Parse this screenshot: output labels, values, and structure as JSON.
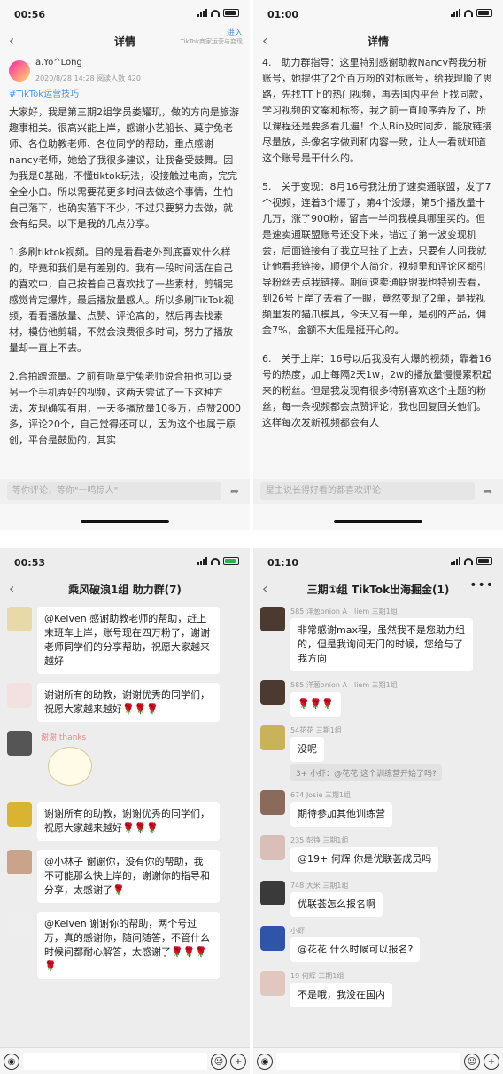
{
  "p1": {
    "time": "00:56",
    "title": "详情",
    "side_top": "进入",
    "side_bottom": "TikTok商家运营与变现",
    "author": "a.Yo^Long",
    "meta": "2020/8/28 14:28  阅读人数 420",
    "tag": "#TikTok运营技巧",
    "paras": [
      "大家好，我是第三期2组学员娄耀玑，做的方向是旅游趣事相关。很高兴能上岸，感谢小艺船长、莫宁兔老师、各位助教老师、各位同学的帮助，重点感谢nancy老师，她给了我很多建议，让我备受鼓舞。因为我是0基础，不懂tiktok玩法，没接触过电商，完完全全小白。所以需要花更多时间去做这个事情，生怕自己落下，也确实落下不少，不过只要努力去做，就会有结果。以下是我的几点分享。",
      "1.多刷tiktok视频。目的是看看老外到底喜欢什么样的，毕竟和我们是有差别的。我有一段时间活在自己的喜欢中，自己按着自己喜欢找了一些素材，剪辑完感觉肯定爆炸，最后播放量感人。所以多刷TikTok视频，看看播放量、点赞、评论高的，然后再去找素材，模仿他剪辑，不然会浪费很多时间，努力了播放量却一直上不去。",
      "2.合拍蹭流量。之前有听莫宁兔老师说合拍也可以录另一个手机弄好的视频，这两天尝试了一下这种方法，发现确实有用，一天多播放量10多万，点赞2000多，评论20个，自己觉得还可以，因为这个也属于原创，平台是鼓励的，其实"
    ],
    "comment_placeholder": "等你评论，等你\"一鸣惊人\""
  },
  "p2": {
    "time": "01:00",
    "title": "详情",
    "paras": [
      "4.　助力群指导：这里特别感谢助教Nancy帮我分析账号，她提供了2个百万粉的对标账号，给我理顺了思路，先找TT上的热门视频，再去国内平台上找同款，学习视频的文案和标签，我之前一直顺序弄反了，所以课程还是要多看几遍！个人Bio及时同步，能放链接尽量放，头像名字做到和内容一致，让人一看就知道这个账号是干什么的。",
      "5.　关于变现：8月16号我注册了速卖通联盟，发了7个视频，连着3个爆了，第4个没爆，第5个播放量十几万，涨了900粉，留言一半问我模具哪里买的。但是速卖通联盟账号还没下来，错过了第一波变现机会，后面链接有了我立马挂了上去，只要有人问我就让他看我链接，顺便个人简介，视频里和评论区都引导粉丝去点我链接。期间速卖通联盟我也特别去看，到26号上岸了去看了一眼，竟然变现了2单，是我视频里发的猫爪模具，今天又有一单，是别的产品，佣金7%，金额不大但是挺开心的。",
      "6.　关于上岸：16号以后我没有大爆的视频，靠着16号的热度，加上每隔2天1w，2w的播放量慢慢累积起来的粉丝。但是我发现有很多特别喜欢这个主题的粉丝，每一条视频都会点赞评论，我也回复回关他们。这样每次发新视频都会有人"
    ],
    "comment_placeholder": "星主说长得好看的都喜欢评论"
  },
  "p3": {
    "time": "00:53",
    "title": "乘风破浪1组 助力群(7)",
    "sticker_text": "谢谢 thanks",
    "msgs": [
      "@Kelven 感谢助教老师的帮助，赶上末班车上岸，账号现在四万粉了，谢谢老师同学们的分享帮助，祝愿大家越来越好",
      "谢谢所有的助教，谢谢优秀的同学们，祝愿大家越来越好🌹🌹🌹",
      "",
      "谢谢所有的助教，谢谢优秀的同学们，祝愿大家越来越好🌹🌹🌹",
      "@小林子 谢谢你，没有你的帮助，我不可能那么快上岸的，谢谢你的指导和分享，太感谢了🌹",
      "@Kelven 谢谢你的帮助，两个号过万，真的感谢你，随问随答，不管什么时候问都耐心解答，太感谢了🌹🌹🌹🌹"
    ]
  },
  "p4": {
    "time": "01:10",
    "title": "三期①组 TikTok出海掘金(1)",
    "msgs": [
      {
        "sender": "585 洋葱onion A　liem 三期1组",
        "text": "非常感谢max程，虽然我不是您助力组的，但是我询问无门的时候，您给与了我方向",
        "quote": ""
      },
      {
        "sender": "585 洋葱onion A　liem 三期1组",
        "text": "🌹🌹🌹",
        "quote": ""
      },
      {
        "sender": "54花花 三期1组",
        "text": "没呢",
        "quote": "3+ 小虾：@花花 这个训练营开始了吗?"
      },
      {
        "sender": "674 Josie 三期1组",
        "text": "期待参加其他训练营",
        "quote": ""
      },
      {
        "sender": "235 彭铮 三期1组",
        "text": "@19+ 何辉 你是优联荟成员吗",
        "quote": ""
      },
      {
        "sender": "748 大米 三期1组",
        "text": "优联荟怎么报名啊",
        "quote": ""
      },
      {
        "sender": "小虾",
        "text": "@花花 什么时候可以报名?",
        "quote": ""
      },
      {
        "sender": "19 何辉 三期1组",
        "text": "不是哦，我没在国内",
        "quote": ""
      }
    ]
  },
  "colors": {
    "accent": "#4a90e2",
    "bubble": "#ffffff",
    "chat_bg": "#ededed"
  },
  "icons": [
    "back-icon",
    "share-icon",
    "voice-icon",
    "emoji-icon",
    "add-icon",
    "more-icon",
    "wifi-icon",
    "battery-icon"
  ]
}
